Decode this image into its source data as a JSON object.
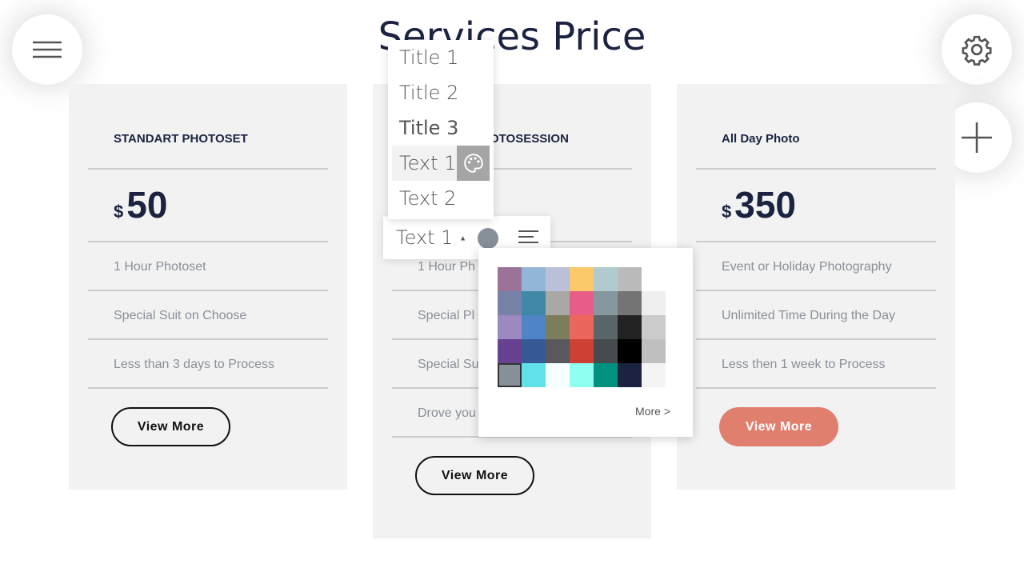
{
  "page_title": "Services Price",
  "cards": [
    {
      "title": "STANDART PHOTOSET",
      "currency": "$",
      "price": "50",
      "features": [
        "1 Hour Photoset",
        "Special Suit on Choose",
        "Less than 3 days to Process"
      ],
      "button": "View More"
    },
    {
      "title": "OTOSESSION",
      "features": [
        "1 Hour Ph",
        "Special Pl",
        "Special Su",
        "Drove you"
      ],
      "button": "View More"
    },
    {
      "title": "All Day Photo",
      "currency": "$",
      "price": "350",
      "features": [
        "Event or Holiday Photography",
        "Unlimited Time During the Day",
        "Less then 1 week to Process"
      ],
      "button": "View More"
    }
  ],
  "style_menu": {
    "items": [
      "Title 1",
      "Title 2",
      "Title 3",
      "Text 1",
      "Text 2"
    ],
    "selected": "Text 1"
  },
  "toolbar": {
    "style_value": "Text 1",
    "current_color": "#878f99"
  },
  "color_picker": {
    "more_label": "More >",
    "selected": "#878f99",
    "rows": [
      [
        "#9b7398",
        "#93b6d8",
        "#b9c0d8",
        "#fbc86a",
        "#b0cace",
        "#bababa",
        null
      ],
      [
        "#7782a8",
        "#3f89a6",
        "#a8a8a4",
        "#e85d88",
        "#86989d",
        "#747474",
        "#efefef"
      ],
      [
        "#9b89bf",
        "#4f84c6",
        "#7c7e5b",
        "#ec665e",
        "#5a656a",
        "#222222",
        "#cbcbcb"
      ],
      [
        "#684290",
        "#375a96",
        "#58585d",
        "#cc4134",
        "#464c4e",
        "#000000",
        "#bfbfbf"
      ],
      [
        "#878f99",
        "#61e2ea",
        "#f5ffff",
        "#8ffff2",
        "#00917f",
        "#1b2340",
        "#f4f4f4"
      ]
    ]
  },
  "colors": {
    "accent": "#e07f6e",
    "heading": "#1b2340"
  }
}
